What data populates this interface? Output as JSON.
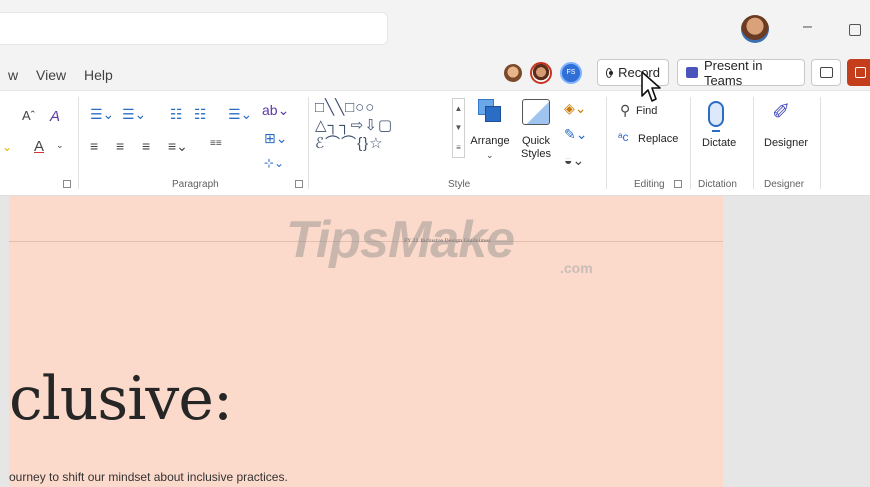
{
  "menu": {
    "tabs": [
      "w",
      "View",
      "Help"
    ]
  },
  "toolbar": {
    "record_label": "Record",
    "present_teams_label": "Present in Teams",
    "collab_initials": "FS"
  },
  "ribbon": {
    "font": {
      "increase_size": "Aˆ",
      "clear_format": "A",
      "font_color": "A"
    },
    "groups": {
      "paragraph": "Paragraph",
      "style": "Style",
      "editing": "Editing",
      "dictation": "Dictation",
      "designer": "Designer"
    },
    "buttons": {
      "arrange": "Arrange",
      "quick_styles": "Quick\nStyles",
      "find": "Find",
      "replace": "Replace",
      "dictate": "Dictate",
      "designer": "Designer"
    },
    "shapes": {
      "row1": "□╲╲□○○",
      "row2": "△┐┐⇨⇩▢",
      "row3": "ℰ⌒⌒{}☆"
    }
  },
  "slide": {
    "header": "FY 21 Inclusive Design Guidelines",
    "title": "clusive:",
    "body": "ourney to shift our mindset about inclusive practices."
  },
  "watermark": {
    "main": "TipsMake",
    "suffix": ".com"
  }
}
